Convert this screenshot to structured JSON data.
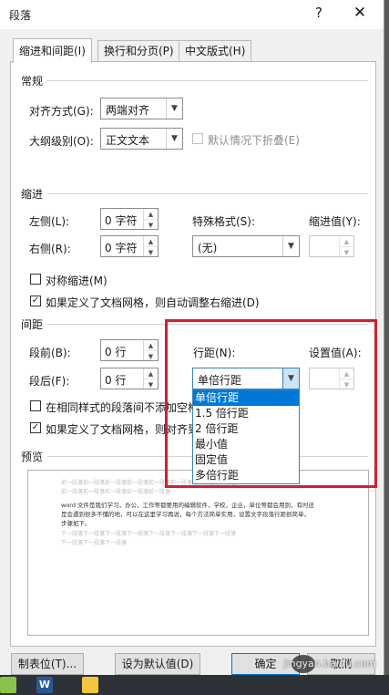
{
  "window": {
    "title": "段落",
    "help_label": "?",
    "close_label": "✕"
  },
  "tabs": [
    {
      "label": "缩进和间距(I)",
      "active": true
    },
    {
      "label": "换行和分页(P)",
      "active": false
    },
    {
      "label": "中文版式(H)",
      "active": false
    }
  ],
  "general": {
    "header": "常规",
    "alignment_label": "对齐方式(G):",
    "alignment_value": "两端对齐",
    "outline_label": "大纲级别(O):",
    "outline_value": "正文文本",
    "collapse_label": "默认情况下折叠(E)"
  },
  "indent": {
    "header": "缩进",
    "left_label": "左侧(L):",
    "left_value": "0 字符",
    "right_label": "右侧(R):",
    "right_value": "0 字符",
    "special_label": "特殊格式(S):",
    "special_value": "(无)",
    "indent_by_label": "缩进值(Y):",
    "mirror_label": "对称缩进(M)",
    "auto_adjust_label": "如果定义了文档网格，则自动调整右缩进(D)"
  },
  "spacing": {
    "header": "间距",
    "before_label": "段前(B):",
    "before_value": "0 行",
    "after_label": "段后(F):",
    "after_value": "0 行",
    "line_spacing_label": "行距(N):",
    "line_spacing_value": "单倍行距",
    "at_label": "设置值(A):",
    "no_space_label": "在相同样式的段落间不添加空格",
    "snap_grid_label": "如果定义了文档网格，则对齐到",
    "options": [
      "单倍行距",
      "1.5 倍行距",
      "2 倍行距",
      "最小值",
      "固定值",
      "多倍行距"
    ]
  },
  "preview": {
    "header": "预览",
    "prev_line1": "前一段落前一段落前一段落前一段落前一段落前一段落前一段落前一段落",
    "prev_line2": "前一段落前一段落前一段落前一段落前一段落",
    "sample1": "word 文件是我们学习，办公，工作等都要用的编辑软件，学校，企业，单位等都会用到，有时还",
    "sample2": "是会遇到很多不懂的地，可以在这里学习再说，每个方法简单实用，设置文字段落行距很简单，",
    "sample3": "步骤如下。",
    "next_line1": "下一段落下一段落下一段落下一段落下一段落下一段落下一段落下一段落",
    "next_line2": "下一段落下一段落下一段落"
  },
  "buttons": {
    "tabs": "制表位(T)...",
    "set_default": "设为默认值(D)",
    "ok": "确定",
    "cancel": "取消"
  },
  "watermark": "jingyan.baidu.com",
  "colors": {
    "highlight_box": "#d41f2a",
    "selection": "#0078d7"
  }
}
